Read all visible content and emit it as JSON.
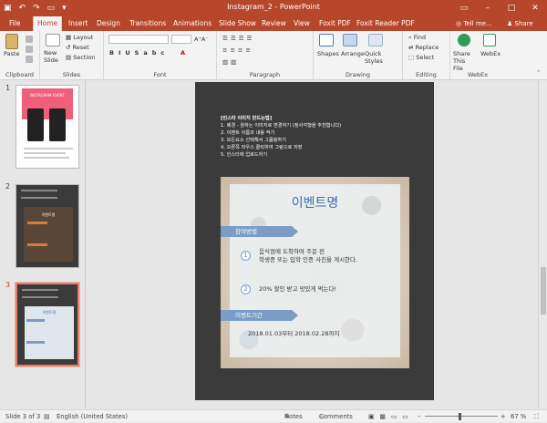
{
  "window": {
    "title": "Instagram_2 - PowerPoint"
  },
  "tabs": [
    {
      "label": "File",
      "active": false
    },
    {
      "label": "Home",
      "active": true
    },
    {
      "label": "Insert",
      "active": false
    },
    {
      "label": "Design",
      "active": false
    },
    {
      "label": "Transitions",
      "active": false
    },
    {
      "label": "Animations",
      "active": false
    },
    {
      "label": "Slide Show",
      "active": false
    },
    {
      "label": "Review",
      "active": false
    },
    {
      "label": "View",
      "active": false
    },
    {
      "label": "Foxit PDF",
      "active": false
    },
    {
      "label": "Foxit Reader PDF",
      "active": false
    }
  ],
  "tell_me": "Tell me...",
  "share": "Share",
  "ribbon": {
    "clipboard": {
      "label": "Clipboard",
      "paste": "Paste"
    },
    "slides": {
      "label": "Slides",
      "new_slide": "New\nSlide",
      "layout": "Layout",
      "reset": "Reset",
      "section": "Section"
    },
    "font": {
      "label": "Font"
    },
    "paragraph": {
      "label": "Paragraph"
    },
    "drawing": {
      "label": "Drawing",
      "shapes": "Shapes",
      "arrange": "Arrange",
      "quick_styles": "Quick Styles"
    },
    "editing": {
      "label": "Editing",
      "find": "Find",
      "replace": "Replace",
      "select": "Select"
    },
    "webex": {
      "label": "WebEx",
      "share_file": "Share This File",
      "webex": "WebEx"
    }
  },
  "thumbnails": [
    {
      "number": "1",
      "title": "INSTAGRAM EVENT"
    },
    {
      "number": "2",
      "title": "이벤트명"
    },
    {
      "number": "3",
      "title": "이벤트명"
    }
  ],
  "slide": {
    "instructions_title": "[인스타 이미지 만드는법]",
    "instructions": [
      "1.   배경 - 원하는 이미지로 변경하기 (정사각형을 추천합니다)",
      "2.   이벤트 이름과 내용 적기",
      "3.   모든요소 선택해서 그룹핑하기",
      "4.   오른쪽 마우스 클릭하여 그림으로 저장",
      "5.   인스타에 업로드하기"
    ],
    "event_title": "이벤트명",
    "how_label": "참여방법",
    "step1_num": "1",
    "step1_line1": "음식점에 도착하여 주문 전",
    "step1_line2": "학생증 또는 입학 인증 사진을 게시한다.",
    "step2_num": "2",
    "step2_text": "20% 할인 받고 맛있게 먹는다!",
    "period_label": "이벤트기간",
    "period": "2018.01.03부터 2018.02.28까지"
  },
  "status": {
    "slide": "Slide 3 of 3",
    "language": "English (United States)",
    "notes": "Notes",
    "comments": "Comments",
    "zoom": "67 %"
  },
  "colors": {
    "accent": "#b7472a",
    "slide_bg": "#3b3b3b",
    "label_blue": "#7a9cc6"
  }
}
